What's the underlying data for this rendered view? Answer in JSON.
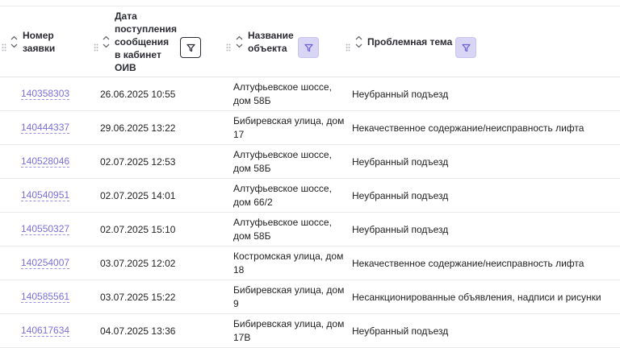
{
  "columns": {
    "number": "Номер заявки",
    "date": "Дата поступления сообщения в кабинет ОИВ",
    "object": "Название объекта",
    "topic": "Проблемная тема"
  },
  "rows": [
    {
      "id": "140358303",
      "date": "26.06.2025 10:55",
      "object": "Алтуфьевское шоссе, дом 58Б",
      "topic": "Неубранный подъезд"
    },
    {
      "id": "140444337",
      "date": "29.06.2025 13:22",
      "object": "Бибиревская улица, дом 17",
      "topic": "Некачественное содержание/неисправность лифта"
    },
    {
      "id": "140528046",
      "date": "02.07.2025 12:53",
      "object": "Алтуфьевское шоссе, дом 58Б",
      "topic": "Неубранный подъезд"
    },
    {
      "id": "140540951",
      "date": "02.07.2025 14:01",
      "object": "Алтуфьевское шоссе, дом 66/2",
      "topic": "Неубранный подъезд"
    },
    {
      "id": "140550327",
      "date": "02.07.2025 15:10",
      "object": "Алтуфьевское шоссе, дом 58Б",
      "topic": "Неубранный подъезд"
    },
    {
      "id": "140254007",
      "date": "03.07.2025 12:02",
      "object": "Костромская улица, дом 18",
      "topic": "Некачественное содержание/неисправность лифта"
    },
    {
      "id": "140585561",
      "date": "03.07.2025 15:22",
      "object": "Бибиревская улица, дом 9",
      "topic": "Несанкционированные объявления, надписи и рисунки"
    },
    {
      "id": "140617634",
      "date": "04.07.2025 13:36",
      "object": "Бибиревская улица, дом 17В",
      "topic": "Неубранный подъезд"
    }
  ],
  "colors": {
    "link": "#7a6fd8",
    "filter_active_bg": "#d9d5f5",
    "border": "#e9e9ee"
  }
}
